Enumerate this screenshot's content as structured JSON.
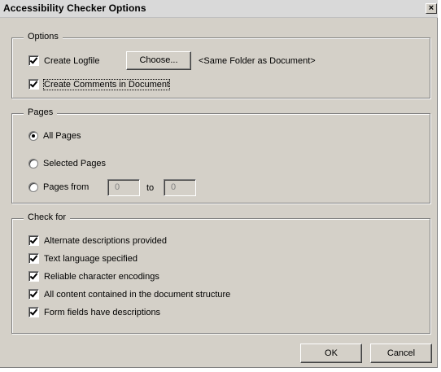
{
  "window": {
    "title": "Accessibility Checker Options",
    "close_glyph": "×"
  },
  "options": {
    "label": "Options",
    "create_logfile": {
      "label": "Create Logfile",
      "checked": true
    },
    "choose_button": "Choose...",
    "folder_text": "<Same Folder as Document>",
    "create_comments": {
      "label": "Create Comments in Document",
      "checked": true
    }
  },
  "pages": {
    "label": "Pages",
    "all_pages": "All Pages",
    "selected_pages": "Selected Pages",
    "pages_from": "Pages from",
    "from_value": "0",
    "to_label": "to",
    "to_value": "0",
    "selected": "all_pages"
  },
  "check_for": {
    "label": "Check for",
    "items": [
      {
        "label": "Alternate descriptions provided",
        "checked": true
      },
      {
        "label": "Text language specified",
        "checked": true
      },
      {
        "label": "Reliable character encodings",
        "checked": true
      },
      {
        "label": "All content contained in the document structure",
        "checked": true
      },
      {
        "label": "Form fields have descriptions",
        "checked": true
      }
    ]
  },
  "buttons": {
    "ok": "OK",
    "cancel": "Cancel"
  }
}
